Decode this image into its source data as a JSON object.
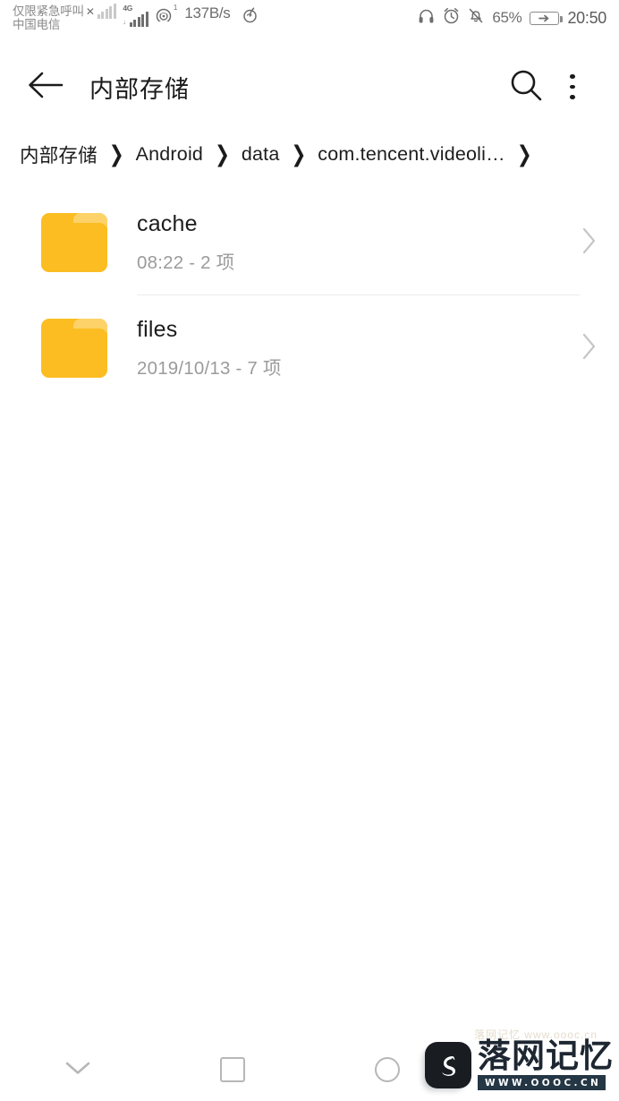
{
  "status_bar": {
    "carrier_line1": "仅限紧急呼叫",
    "carrier_line2": "中国电信",
    "no_service_x": "✕",
    "network_type": "4G",
    "data_arrow": "↓",
    "hotspot_superscript": "1",
    "network_speed": "137B/s",
    "music_icon": "music-note-icon",
    "headphone_icon": "headphone-icon",
    "alarm_icon": "alarm-clock-icon",
    "mute_icon": "bell-muted-icon",
    "battery_percent": "65%",
    "battery_icon": "battery-charging-icon",
    "clock": "20:50"
  },
  "app_bar": {
    "back_icon": "arrow-left-icon",
    "title": "内部存储",
    "search_icon": "search-icon",
    "overflow_icon": "more-vertical-icon"
  },
  "breadcrumb": {
    "separator": "❯",
    "items": [
      {
        "label": "内部存储",
        "clipped": true
      },
      {
        "label": "Android",
        "clipped": false
      },
      {
        "label": "data",
        "clipped": false
      },
      {
        "label": "com.tencent.videoli…",
        "clipped": false
      }
    ]
  },
  "file_list": {
    "rows": [
      {
        "name": "cache",
        "meta": "08:22 - 2 项",
        "icon": "folder-icon",
        "chevron": "chevron-right-icon"
      },
      {
        "name": "files",
        "meta": "2019/10/13 - 7 项",
        "icon": "folder-icon",
        "chevron": "chevron-right-icon"
      }
    ]
  },
  "nav_bar": {
    "back_icon": "chevron-down-icon",
    "recents_icon": "square-icon",
    "home_icon": "circle-icon"
  },
  "watermark": {
    "logo_icon": "swan-logo-icon",
    "brand": "落网记忆",
    "url": "WWW.OOOC.CN",
    "ghost_text": "落网记忆 www.oooc.cn"
  },
  "colors": {
    "folder": "#fbbd22",
    "folder_tab": "#fdd268",
    "text_primary": "#1d1d1d",
    "text_secondary": "#9b9b9b",
    "status_text": "#6e6e6e",
    "divider": "#ececec",
    "nav_icon": "#b7b7b7",
    "watermark_dark": "#16202b"
  }
}
